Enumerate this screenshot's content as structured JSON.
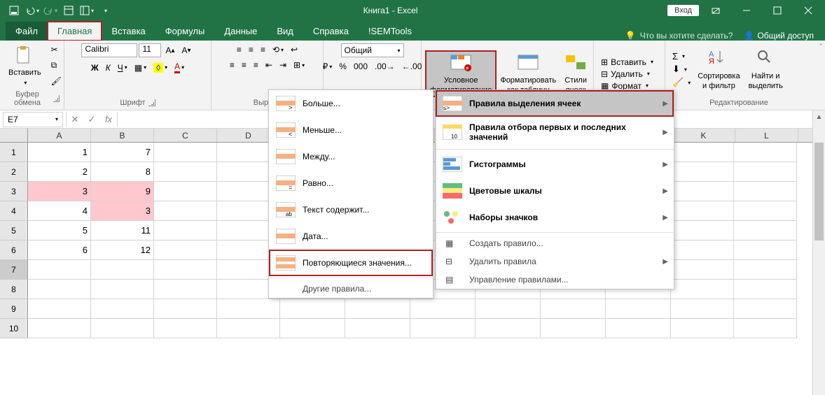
{
  "title": "Книга1 - Excel",
  "login": "Вход",
  "tabs": {
    "file": "Файл",
    "home": "Главная",
    "insert": "Вставка",
    "formulas": "Формулы",
    "data": "Данные",
    "view": "Вид",
    "help": "Справка",
    "sem": "!SEMTools",
    "tell": "Что вы хотите сделать?",
    "share": "Общий доступ"
  },
  "ribbon": {
    "clipboard": {
      "paste": "Вставить",
      "label": "Буфер обмена"
    },
    "font": {
      "name": "Calibri",
      "size": "11",
      "label": "Шрифт"
    },
    "align": {
      "label": "Выравн"
    },
    "number": {
      "format": "Общий"
    },
    "cond": "Условное\nформатирование",
    "table": "Форматировать\nкак таблицу",
    "styles": "Стили\nячеек",
    "cells": {
      "insert": "Вставить",
      "delete": "Удалить",
      "format": "Формат"
    },
    "edit": {
      "sort": "Сортировка\nи фильтр",
      "find": "Найти и\nвыделить",
      "label": "Редактирование"
    }
  },
  "namebox": "E7",
  "cols": [
    "A",
    "B",
    "C",
    "D",
    "",
    "",
    "",
    "",
    "",
    "",
    "K",
    "L"
  ],
  "rows": [
    {
      "n": "1",
      "a": "1",
      "b": "7"
    },
    {
      "n": "2",
      "a": "2",
      "b": "8"
    },
    {
      "n": "3",
      "a": "3",
      "b": "9",
      "pink": true
    },
    {
      "n": "4",
      "a": "4",
      "b": "3",
      "pinkB": true
    },
    {
      "n": "5",
      "a": "5",
      "b": "11"
    },
    {
      "n": "6",
      "a": "6",
      "b": "12"
    },
    {
      "n": "7",
      "a": "",
      "b": "",
      "active": true
    },
    {
      "n": "8",
      "a": "",
      "b": ""
    },
    {
      "n": "9",
      "a": "",
      "b": ""
    },
    {
      "n": "10",
      "a": "",
      "b": ""
    }
  ],
  "dd_main": {
    "highlight": "Правила выделения ячеек",
    "top": "Правила отбора первых и последних значений",
    "bars": "Гистограммы",
    "scales": "Цветовые шкалы",
    "icons": "Наборы значков",
    "new": "Создать правило...",
    "clear": "Удалить правила",
    "manage": "Управление правилами..."
  },
  "dd_sub": {
    "gt": "Больше...",
    "lt": "Меньше...",
    "between": "Между...",
    "eq": "Равно...",
    "text": "Текст содержит...",
    "date": "Дата...",
    "dup": "Повторяющиеся значения...",
    "other": "Другие правила..."
  }
}
